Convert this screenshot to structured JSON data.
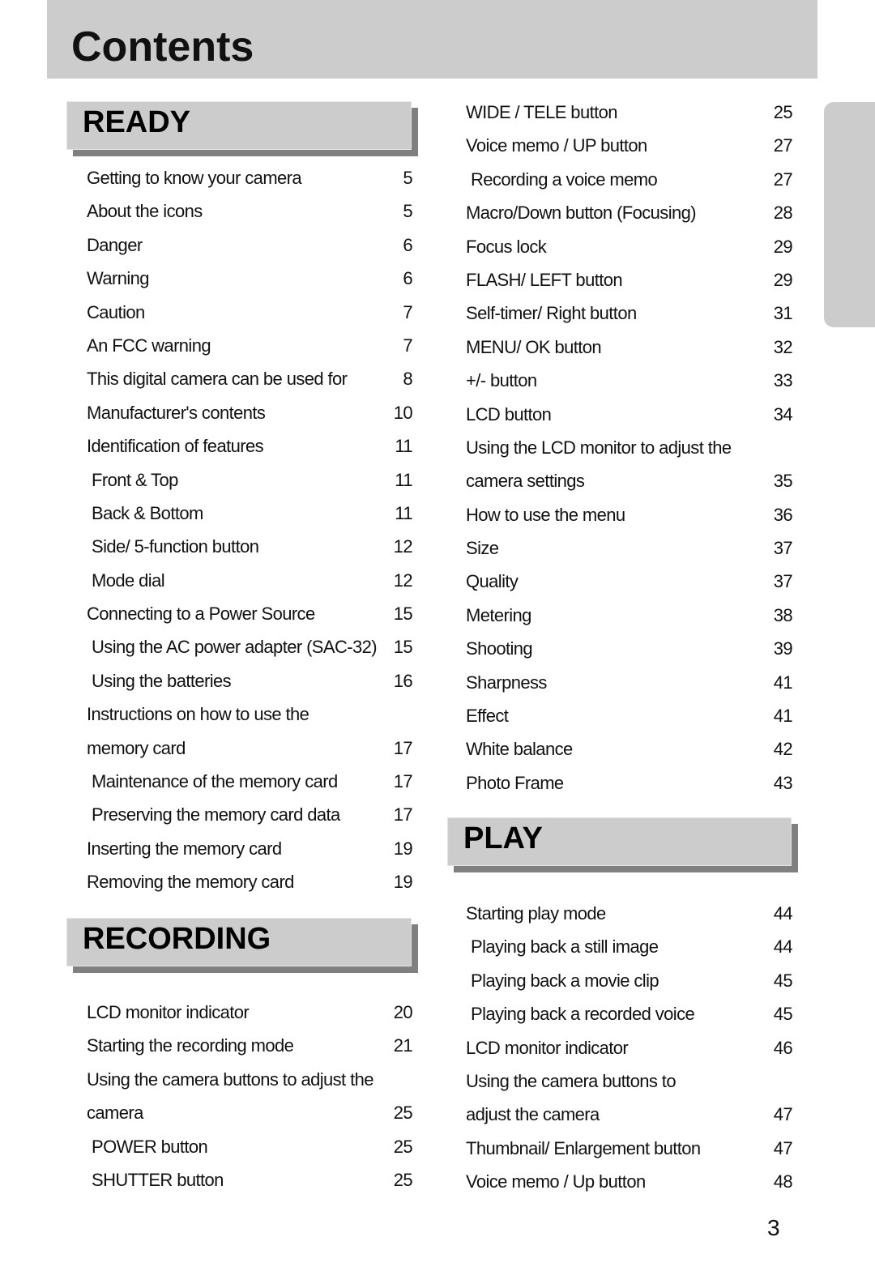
{
  "page": {
    "title": "Contents",
    "page_number": "3"
  },
  "sections": {
    "ready": {
      "heading": "READY",
      "items": [
        {
          "text": "Getting to know your camera",
          "page": "5"
        },
        {
          "text": "About the icons",
          "page": "5"
        },
        {
          "text": "Danger",
          "page": "6"
        },
        {
          "text": "Warning",
          "page": "6"
        },
        {
          "text": "Caution",
          "page": "7"
        },
        {
          "text": "An FCC warning",
          "page": "7"
        },
        {
          "text": "This digital camera can be used for",
          "page": "8"
        },
        {
          "text": "Manufacturer's contents",
          "page": "10"
        },
        {
          "text": "Identification of features",
          "page": "11"
        },
        {
          "text": "Front & Top",
          "page": "11",
          "sub": true
        },
        {
          "text": "Back & Bottom",
          "page": "11",
          "sub": true
        },
        {
          "text": "Side/ 5-function button",
          "page": "12",
          "sub": true
        },
        {
          "text": "Mode dial",
          "page": "12",
          "sub": true
        },
        {
          "text": "Connecting to a Power Source",
          "page": "15"
        },
        {
          "text": "Using the AC power adapter (SAC-32)",
          "page": "15",
          "sub": true
        },
        {
          "text": "Using the batteries",
          "page": "16",
          "sub": true
        },
        {
          "text": "Instructions on how to use the",
          "page": ""
        },
        {
          "text": "memory card",
          "page": "17"
        },
        {
          "text": "Maintenance of the memory card",
          "page": "17",
          "sub": true
        },
        {
          "text": "Preserving the memory card data",
          "page": "17",
          "sub": true
        },
        {
          "text": "Inserting the memory card",
          "page": "19"
        },
        {
          "text": "Removing the memory card",
          "page": "19"
        }
      ]
    },
    "recording": {
      "heading": "RECORDING",
      "items": [
        {
          "text": "LCD monitor indicator",
          "page": "20"
        },
        {
          "text": "Starting the recording mode",
          "page": "21"
        },
        {
          "text": "Using the camera buttons to adjust the",
          "page": ""
        },
        {
          "text": "camera",
          "page": "25"
        },
        {
          "text": "POWER button",
          "page": "25",
          "sub": true
        },
        {
          "text": "SHUTTER button",
          "page": "25",
          "sub": true
        }
      ],
      "continued_items": [
        {
          "text": "WIDE / TELE button",
          "page": "25"
        },
        {
          "text": "Voice memo / UP button",
          "page": "27"
        },
        {
          "text": "Recording a voice memo",
          "page": "27",
          "sub": true
        },
        {
          "text": "Macro/Down button (Focusing)",
          "page": "28"
        },
        {
          "text": "Focus lock",
          "page": "29"
        },
        {
          "text": "FLASH/ LEFT button",
          "page": "29"
        },
        {
          "text": "Self-timer/ Right button",
          "page": "31"
        },
        {
          "text": "MENU/ OK button",
          "page": "32"
        },
        {
          "text": "+/- button",
          "page": "33"
        },
        {
          "text": "LCD button",
          "page": "34"
        },
        {
          "text": "Using the LCD monitor to adjust the",
          "page": ""
        },
        {
          "text": "camera settings",
          "page": "35"
        },
        {
          "text": "How to use the menu",
          "page": "36"
        },
        {
          "text": "Size",
          "page": "37"
        },
        {
          "text": "Quality",
          "page": "37"
        },
        {
          "text": "Metering",
          "page": "38"
        },
        {
          "text": "Shooting",
          "page": "39"
        },
        {
          "text": "Sharpness",
          "page": "41"
        },
        {
          "text": "Effect",
          "page": "41"
        },
        {
          "text": "White balance",
          "page": "42"
        },
        {
          "text": "Photo Frame",
          "page": "43"
        }
      ]
    },
    "play": {
      "heading": "PLAY",
      "items": [
        {
          "text": "Starting play mode",
          "page": "44"
        },
        {
          "text": "Playing back a still image",
          "page": "44",
          "sub": true
        },
        {
          "text": "Playing back a movie clip",
          "page": "45",
          "sub": true
        },
        {
          "text": "Playing back a recorded voice",
          "page": "45",
          "sub": true
        },
        {
          "text": "LCD monitor indicator",
          "page": "46"
        },
        {
          "text": "Using the camera buttons to",
          "page": ""
        },
        {
          "text": "adjust the camera",
          "page": "47"
        },
        {
          "text": "Thumbnail/ Enlargement button",
          "page": "47"
        },
        {
          "text": "Voice memo / Up button",
          "page": "48"
        }
      ]
    }
  }
}
